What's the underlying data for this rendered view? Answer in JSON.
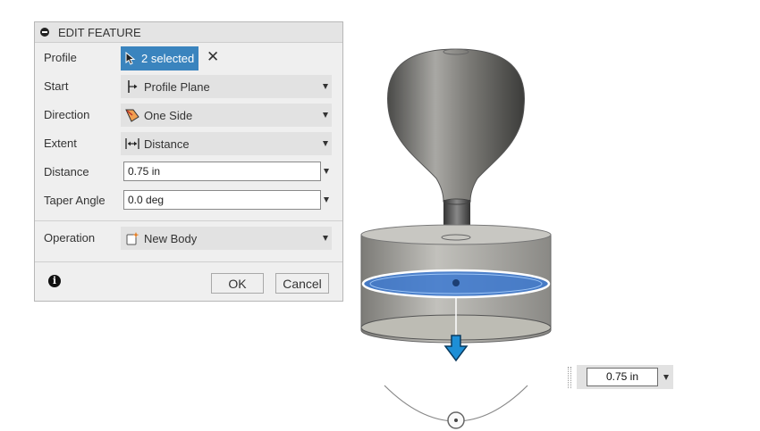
{
  "panel": {
    "title": "EDIT FEATURE",
    "profile": {
      "label": "Profile",
      "selection": "2 selected"
    },
    "start": {
      "label": "Start",
      "value": "Profile Plane"
    },
    "direction": {
      "label": "Direction",
      "value": "One Side"
    },
    "extent": {
      "label": "Extent",
      "value": "Distance"
    },
    "distance": {
      "label": "Distance",
      "value": "0.75 in"
    },
    "taper": {
      "label": "Taper Angle",
      "value": "0.0 deg"
    },
    "operation": {
      "label": "Operation",
      "value": "New Body"
    },
    "ok_label": "OK",
    "cancel_label": "Cancel"
  },
  "viewport": {
    "distance_input": "0.75 in",
    "accent_color": "#1e8fd6",
    "selection_color": "#3a84be"
  }
}
